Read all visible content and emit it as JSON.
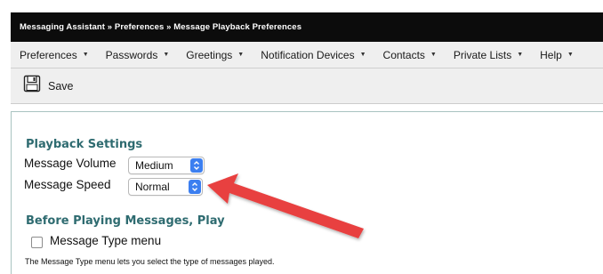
{
  "breadcrumb": "Messaging Assistant » Preferences » Message Playback Preferences",
  "menu": [
    {
      "label": "Preferences"
    },
    {
      "label": "Passwords"
    },
    {
      "label": "Greetings"
    },
    {
      "label": "Notification Devices"
    },
    {
      "label": "Contacts"
    },
    {
      "label": "Private Lists"
    },
    {
      "label": "Help"
    }
  ],
  "toolbar": {
    "save_label": "Save",
    "save_icon": "floppy-disk-icon"
  },
  "playback": {
    "title": "Playback Settings",
    "volume_label": "Message Volume",
    "volume_value": "Medium",
    "speed_label": "Message Speed",
    "speed_value": "Normal"
  },
  "before_playing": {
    "title": "Before Playing Messages, Play",
    "message_type_label": "Message Type menu",
    "message_type_checked": false,
    "help_text": "The Message Type menu lets you select the type of messages played."
  },
  "colors": {
    "title_bar": "#0c0c0c",
    "menu_bar": "#efefef",
    "section_title": "#2e6b70",
    "select_stepper": "#3c7ff0",
    "arrow": "#e8413f"
  },
  "icons": {
    "menu_caret": "caret-down-icon",
    "annotation": "red-arrow-icon"
  }
}
